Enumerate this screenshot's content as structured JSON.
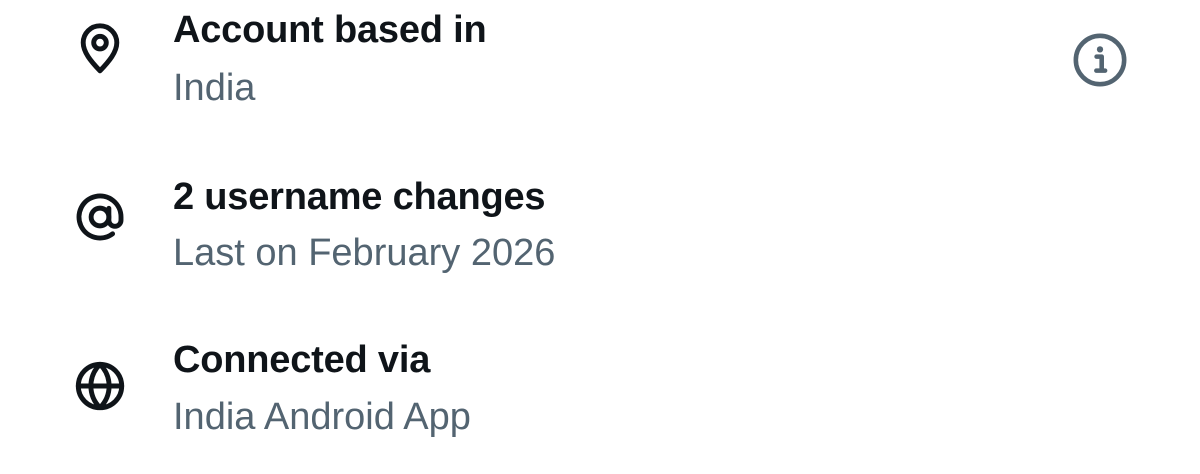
{
  "rows": [
    {
      "icon": "location-pin-icon",
      "title": "Account based in",
      "subtitle": "India"
    },
    {
      "icon": "at-sign-icon",
      "title": "2 username changes",
      "subtitle": "Last on February 2026"
    },
    {
      "icon": "globe-icon",
      "title": "Connected via",
      "subtitle": "India Android App"
    }
  ],
  "info_icon": "info-icon",
  "colors": {
    "primary_text": "#0f1419",
    "secondary_text": "#536471",
    "background": "#ffffff"
  }
}
